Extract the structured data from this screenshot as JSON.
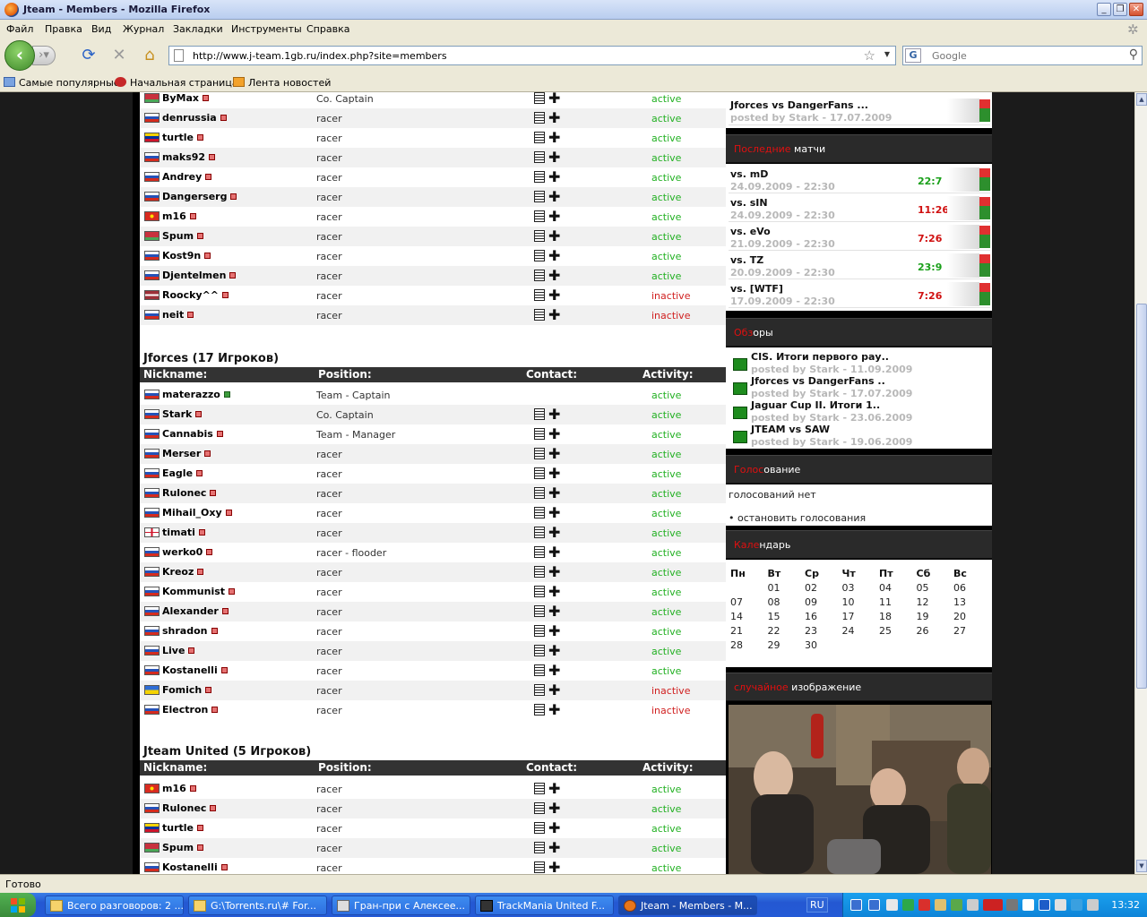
{
  "window": {
    "title": "Jteam - Members - Mozilla Firefox"
  },
  "menu": [
    "Файл",
    "Правка",
    "Вид",
    "Журнал",
    "Закладки",
    "Инструменты",
    "Справка"
  ],
  "nav": {
    "url": "http://www.j-team.1gb.ru/index.php?site=members",
    "search_placeholder": "Google"
  },
  "bookmarks": [
    "Самые популярные",
    "Начальная страница",
    "Лента новостей"
  ],
  "columns": {
    "nickname": "Nickname:",
    "position": "Position:",
    "contact": "Contact:",
    "activity": "Activity:"
  },
  "team1_rows": [
    {
      "nick": "ByMax",
      "flag": "by",
      "pos": "Co. Captain",
      "act": "active",
      "online": false
    },
    {
      "nick": "denrussia",
      "flag": "ru",
      "pos": "racer",
      "act": "active",
      "online": false
    },
    {
      "nick": "turtle",
      "flag": "ve",
      "pos": "racer",
      "act": "active",
      "online": false
    },
    {
      "nick": "maks92",
      "flag": "ru",
      "pos": "racer",
      "act": "active",
      "online": false
    },
    {
      "nick": "Andrey",
      "flag": "ru",
      "pos": "racer",
      "act": "active",
      "online": false
    },
    {
      "nick": "Dangerserg",
      "flag": "ru",
      "pos": "racer",
      "act": "active",
      "online": false
    },
    {
      "nick": "m16",
      "flag": "vn",
      "pos": "racer",
      "act": "active",
      "online": false
    },
    {
      "nick": "Spum",
      "flag": "by",
      "pos": "racer",
      "act": "active",
      "online": false
    },
    {
      "nick": "Kost9n",
      "flag": "ru",
      "pos": "racer",
      "act": "active",
      "online": false
    },
    {
      "nick": "Djentelmen",
      "flag": "ru",
      "pos": "racer",
      "act": "active",
      "online": false
    },
    {
      "nick": "Roocky^^",
      "flag": "lv",
      "pos": "racer",
      "act": "inactive",
      "online": false
    },
    {
      "nick": "neit",
      "flag": "ru",
      "pos": "racer",
      "act": "inactive",
      "online": false
    }
  ],
  "team2": {
    "title": "Jforces (17 Игроков)"
  },
  "team2_rows": [
    {
      "nick": "materazzo",
      "flag": "ru",
      "pos": "Team - Captain",
      "act": "active",
      "online": true,
      "no_contact": true
    },
    {
      "nick": "Stark",
      "flag": "ru",
      "pos": "Co. Captain",
      "act": "active",
      "online": false
    },
    {
      "nick": "Cannabis",
      "flag": "ru",
      "pos": "Team - Manager",
      "act": "active",
      "online": false
    },
    {
      "nick": "Merser",
      "flag": "ru",
      "pos": "racer",
      "act": "active",
      "online": false
    },
    {
      "nick": "Eagle",
      "flag": "ru",
      "pos": "racer",
      "act": "active",
      "online": false
    },
    {
      "nick": "Rulonec",
      "flag": "ru",
      "pos": "racer",
      "act": "active",
      "online": false
    },
    {
      "nick": "Mihail_Oxy",
      "flag": "ru",
      "pos": "racer",
      "act": "active",
      "online": false
    },
    {
      "nick": "timati",
      "flag": "en",
      "pos": "racer",
      "act": "active",
      "online": false
    },
    {
      "nick": "werko0",
      "flag": "ru",
      "pos": "racer - flooder",
      "act": "active",
      "online": false
    },
    {
      "nick": "Kreoz",
      "flag": "ru",
      "pos": "racer",
      "act": "active",
      "online": false
    },
    {
      "nick": "Kommunist",
      "flag": "ru",
      "pos": "racer",
      "act": "active",
      "online": false
    },
    {
      "nick": "Alexander",
      "flag": "ru",
      "pos": "racer",
      "act": "active",
      "online": false
    },
    {
      "nick": "shradon",
      "flag": "ru",
      "pos": "racer",
      "act": "active",
      "online": false
    },
    {
      "nick": "Live",
      "flag": "ru",
      "pos": "racer",
      "act": "active",
      "online": false
    },
    {
      "nick": "Kostanelli",
      "flag": "ru",
      "pos": "racer",
      "act": "active",
      "online": false
    },
    {
      "nick": "Fomich",
      "flag": "ua",
      "pos": "racer",
      "act": "inactive",
      "online": false
    },
    {
      "nick": "Electron",
      "flag": "ru",
      "pos": "racer",
      "act": "inactive",
      "online": false
    }
  ],
  "team3": {
    "title": "Jteam United (5 Игроков)"
  },
  "team3_rows": [
    {
      "nick": "m16",
      "flag": "vn",
      "pos": "racer",
      "act": "active",
      "online": false
    },
    {
      "nick": "Rulonec",
      "flag": "ru",
      "pos": "racer",
      "act": "active",
      "online": false
    },
    {
      "nick": "turtle",
      "flag": "ve",
      "pos": "racer",
      "act": "active",
      "online": false
    },
    {
      "nick": "Spum",
      "flag": "by",
      "pos": "racer",
      "act": "active",
      "online": false
    },
    {
      "nick": "Kostanelli",
      "flag": "ru",
      "pos": "racer",
      "act": "active",
      "online": false
    }
  ],
  "sidebar": {
    "news_top": {
      "t1": "Jforces vs DangerFans ...",
      "t2": "posted by Stark - 17.07.2009"
    },
    "matches_head_red": "Последние",
    "matches_head_rest": " матчи",
    "matches": [
      {
        "opp": "vs. mD",
        "date": "24.09.2009 - 22:30",
        "score": "22:7",
        "win": true
      },
      {
        "opp": "vs. sIN",
        "date": "24.09.2009 - 22:30",
        "score": "11:26",
        "win": false
      },
      {
        "opp": "vs. eVo",
        "date": "21.09.2009 - 22:30",
        "score": "7:26",
        "win": false
      },
      {
        "opp": "vs. TZ",
        "date": "20.09.2009 - 22:30",
        "score": "23:9",
        "win": true
      },
      {
        "opp": "vs. [WTF]",
        "date": "17.09.2009 - 22:30",
        "score": "7:26",
        "win": false
      }
    ],
    "reviews_head_red": "Обз",
    "reviews_head_rest": "оры",
    "reviews": [
      {
        "t1": "CIS. Итоги первого рау..",
        "t2": "posted by Stark - 11.09.2009"
      },
      {
        "t1": "Jforces vs DangerFans ..",
        "t2": "posted by Stark - 17.07.2009"
      },
      {
        "t1": "Jaguar Cup II. Итоги 1..",
        "t2": "posted by Stark - 23.06.2009"
      },
      {
        "t1": "JTEAM vs SAW",
        "t2": "posted by Stark - 19.06.2009"
      }
    ],
    "poll_head_red": "Голос",
    "poll_head_rest": "ование",
    "poll_text": "голосований нет",
    "poll_link": "• остановить голосования",
    "cal_head_red": "Кале",
    "cal_head_rest": "ндарь",
    "cal_days": [
      "Пн",
      "Вт",
      "Ср",
      "Чт",
      "Пт",
      "Сб",
      "Вс"
    ],
    "cal_weeks": [
      [
        "",
        "01",
        "02",
        "03",
        "04",
        "05",
        "06"
      ],
      [
        "07",
        "08",
        "09",
        "10",
        "11",
        "12",
        "13"
      ],
      [
        "14",
        "15",
        "16",
        "17",
        "18",
        "19",
        "20"
      ],
      [
        "21",
        "22",
        "23",
        "24",
        "25",
        "26",
        "27"
      ],
      [
        "28",
        "29",
        "30",
        "",
        "",
        "",
        ""
      ]
    ],
    "img_head_red": "случайное",
    "img_head_rest": " изображение"
  },
  "status": "Готово",
  "taskbar": {
    "start": "",
    "tasks": [
      "Всего разговоров: 2 ...",
      "G:\\Torrents.ru\\# For...",
      "Гран-при с Алексее...",
      "TrackMania United F...",
      "Jteam - Members - M..."
    ],
    "lang": "RU",
    "clock": "13:32"
  },
  "colors": {
    "active": "#22b022",
    "inactive": "#d02020",
    "accent_red": "#e01010"
  }
}
